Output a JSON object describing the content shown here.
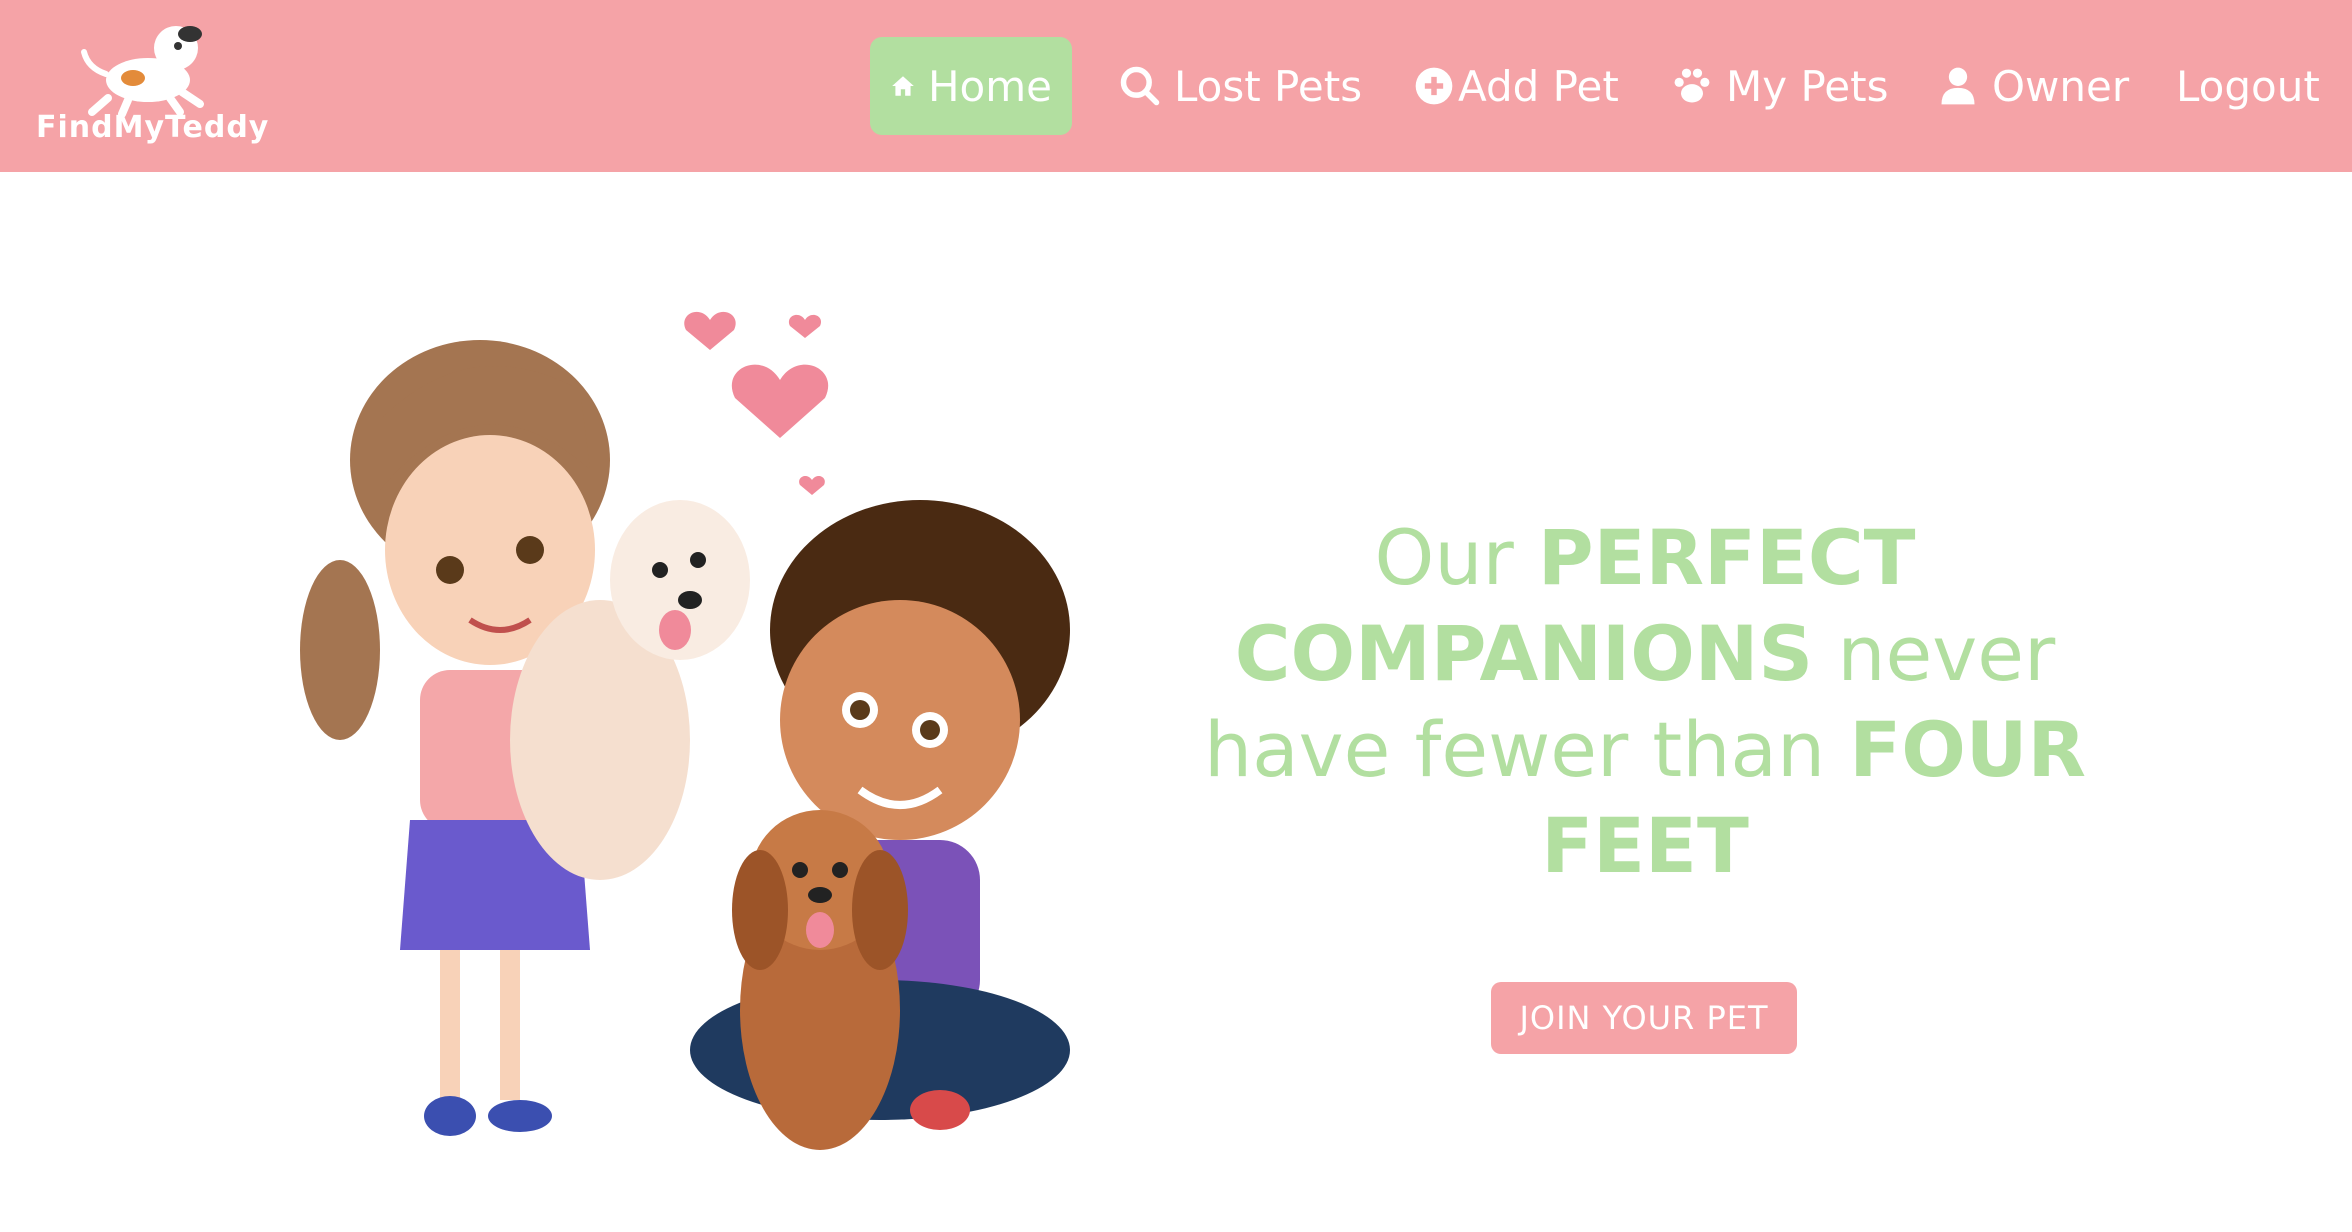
{
  "brand": {
    "name": "FindMyTeddy",
    "logo_icon": "dog-logo-icon"
  },
  "nav": {
    "items": [
      {
        "label": "Home",
        "icon": "home-icon",
        "active": true
      },
      {
        "label": "Lost Pets",
        "icon": "search-icon",
        "active": false
      },
      {
        "label": "Add Pet",
        "icon": "plus-circle-icon",
        "active": false
      },
      {
        "label": "My Pets",
        "icon": "paw-icon",
        "active": false
      },
      {
        "label": "Owner",
        "icon": "user-icon",
        "active": false
      },
      {
        "label": "Logout",
        "icon": "",
        "active": false
      }
    ]
  },
  "hero": {
    "headline_parts": [
      {
        "text": "Our ",
        "bold": false
      },
      {
        "text": "PERFECT COMPANIONS",
        "bold": true
      },
      {
        "text": " never have fewer than ",
        "bold": false
      },
      {
        "text": "FOUR FEET",
        "bold": true
      }
    ],
    "cta_label": "JOIN YOUR PET",
    "illustration": "kids-with-dogs-illustration"
  },
  "colors": {
    "navbar_bg": "#f5a3a7",
    "active_tab_bg": "#b2dfa0",
    "headline": "#b2dfa0",
    "cta_bg": "#f5a3a7"
  }
}
